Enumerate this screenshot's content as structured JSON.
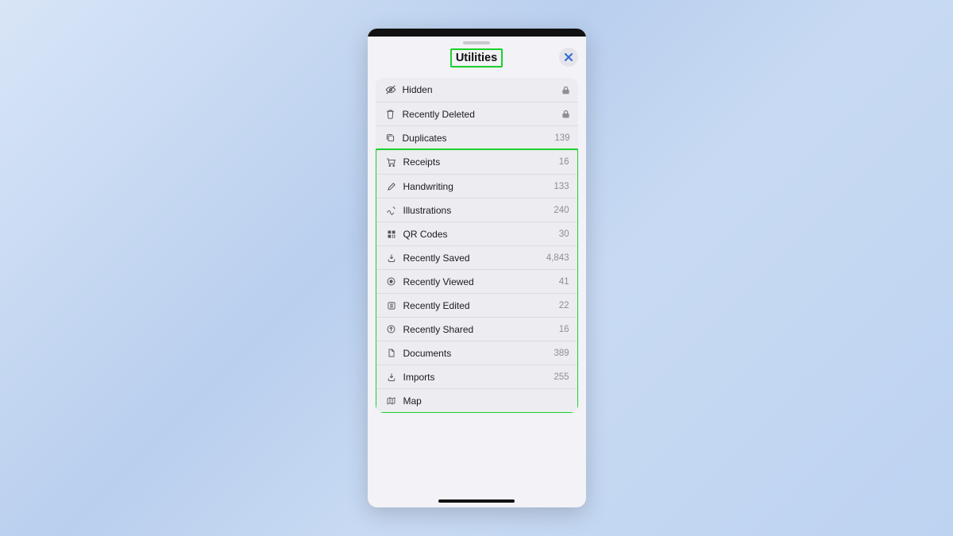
{
  "header": {
    "title": "Utilities"
  },
  "rows": {
    "hidden": {
      "label": "Hidden"
    },
    "recently_deleted": {
      "label": "Recently Deleted"
    },
    "duplicates": {
      "label": "Duplicates",
      "count": "139"
    },
    "receipts": {
      "label": "Receipts",
      "count": "16"
    },
    "handwriting": {
      "label": "Handwriting",
      "count": "133"
    },
    "illustrations": {
      "label": "Illustrations",
      "count": "240"
    },
    "qr_codes": {
      "label": "QR Codes",
      "count": "30"
    },
    "recently_saved": {
      "label": "Recently Saved",
      "count": "4,843"
    },
    "recently_viewed": {
      "label": "Recently Viewed",
      "count": "41"
    },
    "recently_edited": {
      "label": "Recently Edited",
      "count": "22"
    },
    "recently_shared": {
      "label": "Recently Shared",
      "count": "16"
    },
    "documents": {
      "label": "Documents",
      "count": "389"
    },
    "imports": {
      "label": "Imports",
      "count": "255"
    },
    "map": {
      "label": "Map"
    }
  }
}
